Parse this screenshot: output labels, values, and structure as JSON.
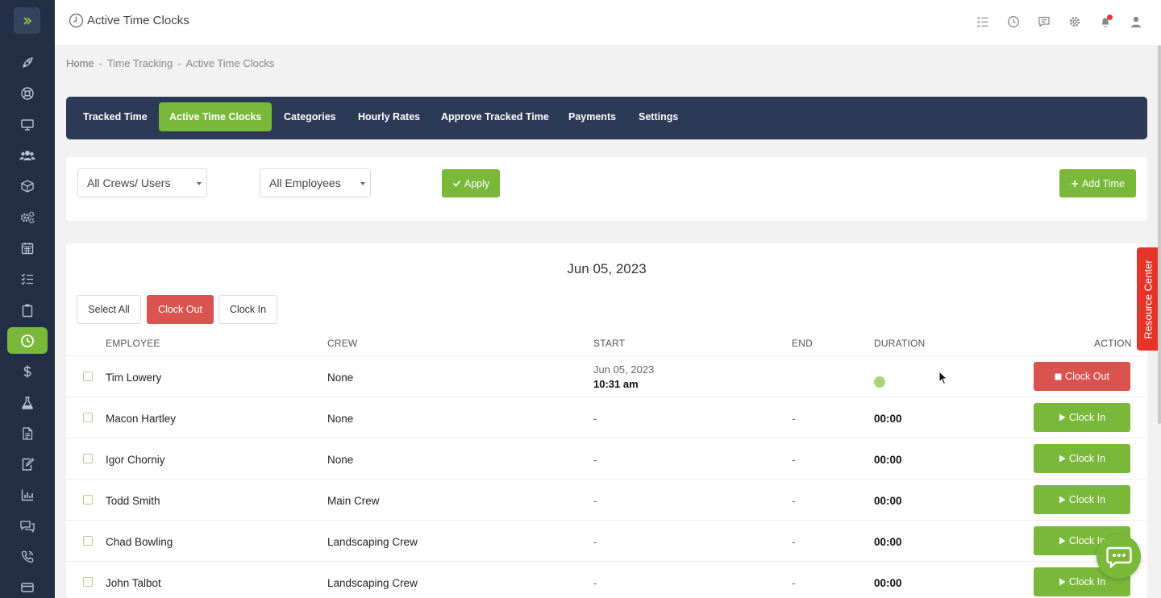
{
  "header": {
    "title": "Active Time Clocks"
  },
  "breadcrumb": [
    "Home",
    "Time Tracking",
    "Active Time Clocks"
  ],
  "breadcrumb_separator": "-",
  "tabs": [
    {
      "label": "Tracked Time",
      "active": false
    },
    {
      "label": "Active Time Clocks",
      "active": true
    },
    {
      "label": "Categories",
      "active": false
    },
    {
      "label": "Hourly Rates",
      "active": false
    },
    {
      "label": "Approve Tracked Time",
      "active": false
    },
    {
      "label": "Payments",
      "active": false
    },
    {
      "label": "Settings",
      "active": false
    }
  ],
  "filters": {
    "crew_select": "All Crews/ Users",
    "employee_select": "All Employees",
    "apply_label": "Apply",
    "add_time_label": "Add Time"
  },
  "date_heading": "Jun 05, 2023",
  "bulk_actions": {
    "select_all": "Select All",
    "clock_out": "Clock Out",
    "clock_in": "Clock In"
  },
  "table": {
    "headers": {
      "employee": "EMPLOYEE",
      "crew": "CREW",
      "start": "START",
      "end": "END",
      "duration": "DURATION",
      "action": "ACTION"
    },
    "rows": [
      {
        "employee": "Tim Lowery",
        "crew": "None",
        "start_date": "Jun 05, 2023",
        "start_time": "10:31 am",
        "end": "",
        "duration": "",
        "running": true,
        "action": "Clock Out"
      },
      {
        "employee": "Macon Hartley",
        "crew": "None",
        "start": "-",
        "end": "-",
        "duration": "00:00",
        "running": false,
        "action": "Clock In"
      },
      {
        "employee": "Igor Chorniy",
        "crew": "None",
        "start": "-",
        "end": "-",
        "duration": "00:00",
        "running": false,
        "action": "Clock In"
      },
      {
        "employee": "Todd Smith",
        "crew": "Main Crew",
        "start": "-",
        "end": "-",
        "duration": "00:00",
        "running": false,
        "action": "Clock In"
      },
      {
        "employee": "Chad Bowling",
        "crew": "Landscaping Crew",
        "start": "-",
        "end": "-",
        "duration": "00:00",
        "running": false,
        "action": "Clock In"
      },
      {
        "employee": "John Talbot",
        "crew": "Landscaping Crew",
        "start": "-",
        "end": "-",
        "duration": "00:00",
        "running": false,
        "action": "Clock In"
      }
    ]
  },
  "resource_center": "Resource Center",
  "sidebar": {
    "items": [
      {
        "icon": "rocket-icon",
        "active": false
      },
      {
        "icon": "lifebuoy-icon",
        "active": false
      },
      {
        "icon": "monitor-icon",
        "active": false
      },
      {
        "icon": "users-icon",
        "active": false
      },
      {
        "icon": "cube-icon",
        "active": false
      },
      {
        "icon": "gears-icon",
        "active": false
      },
      {
        "icon": "calendar-icon",
        "active": false
      },
      {
        "icon": "checklist-icon",
        "active": false
      },
      {
        "icon": "clipboard-icon",
        "active": false
      },
      {
        "icon": "clock-icon",
        "active": true
      },
      {
        "icon": "dollar-icon",
        "active": false
      },
      {
        "icon": "flask-icon",
        "active": false
      },
      {
        "icon": "document-icon",
        "active": false
      },
      {
        "icon": "edit-document-icon",
        "active": false
      },
      {
        "icon": "bar-chart-icon",
        "active": false
      },
      {
        "icon": "chat-icon",
        "active": false
      },
      {
        "icon": "phone-icon",
        "active": false
      },
      {
        "icon": "card-icon",
        "active": false
      }
    ]
  },
  "colors": {
    "sidebar": "#232f47",
    "nav": "#2d3a55",
    "accent_green": "#7ab83a",
    "danger_red": "#d9534f",
    "resource_red": "#e53329"
  }
}
